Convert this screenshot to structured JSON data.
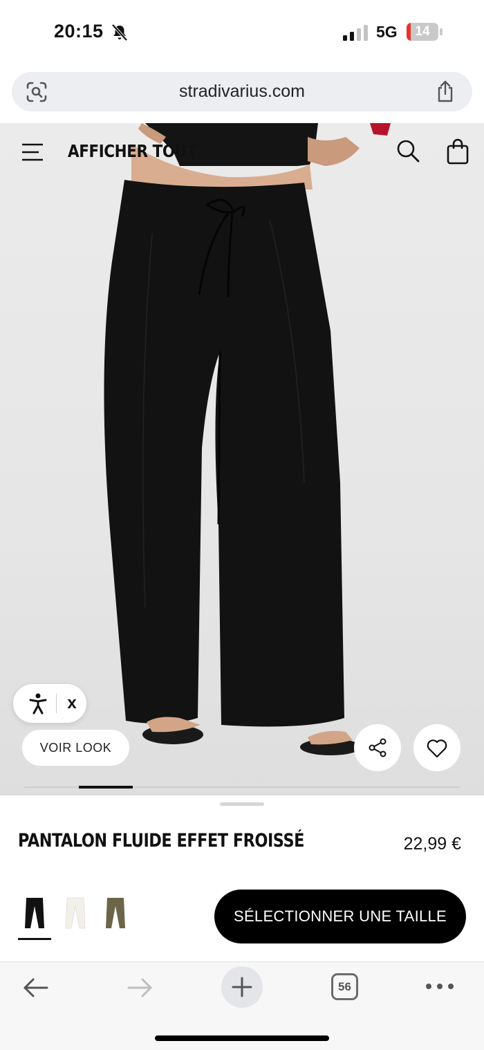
{
  "status_bar": {
    "time": "20:15",
    "network": "5G",
    "battery_level": "14",
    "battery_fraction": 0.14
  },
  "url_bar": {
    "url": "stradivarius.com"
  },
  "site_nav": {
    "title": "AFFICHER TOUT"
  },
  "hero": {
    "accessibility_close": "x",
    "voir_look_label": "VOIR LOOK",
    "gallery_active_index": 2,
    "gallery_count": 8
  },
  "product": {
    "name": "PANTALON FLUIDE EFFET FROISSÉ",
    "price": "22,99 €",
    "swatches": [
      {
        "name": "black",
        "color": "#111111",
        "selected": true
      },
      {
        "name": "white",
        "color": "#f3f0ea",
        "selected": false
      },
      {
        "name": "khaki",
        "color": "#6b6648",
        "selected": false
      }
    ],
    "size_button_label": "SÉLECTIONNER UNE TAILLE"
  },
  "browser_toolbar": {
    "tab_count": "56"
  }
}
